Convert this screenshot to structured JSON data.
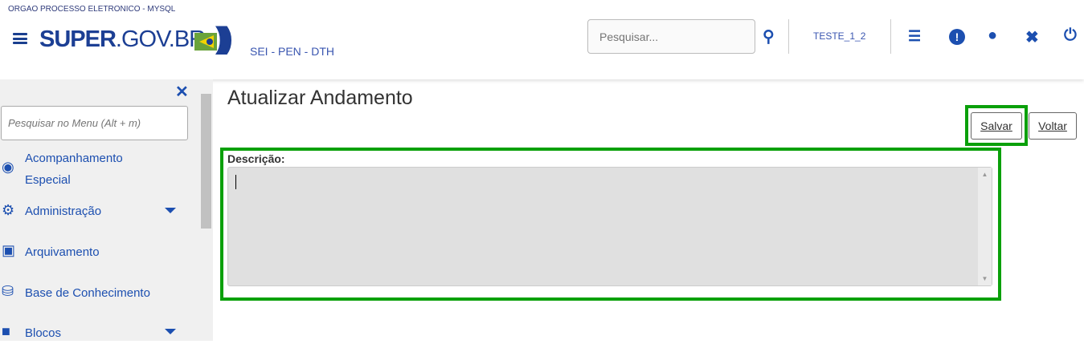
{
  "header": {
    "org": "ORGAO PROCESSO ELETRONICO - MYSQL",
    "logo_bold": "SUPER",
    "logo_rest": ".GOV.BR",
    "subtitle": "SEI - PEN - DTH",
    "search_placeholder": "Pesquisar...",
    "user": "TESTE_1_2"
  },
  "sidebar": {
    "search_placeholder": "Pesquisar no Menu (Alt + m)",
    "items": [
      {
        "label": "Acompanhamento Especial",
        "icon": "eye-icon"
      },
      {
        "label": "Administração",
        "icon": "gears-icon"
      },
      {
        "label": "Arquivamento",
        "icon": "archive-icon"
      },
      {
        "label": "Base de Conhecimento",
        "icon": "database-icon"
      },
      {
        "label": "Blocos",
        "icon": "cubes-icon"
      }
    ]
  },
  "main": {
    "title": "Atualizar Andamento",
    "save": "Salvar",
    "back": "Voltar",
    "description_label": "Descrição:",
    "description_value": ""
  },
  "colors": {
    "brand": "#1c4fb0",
    "highlight": "#0aa00a"
  }
}
